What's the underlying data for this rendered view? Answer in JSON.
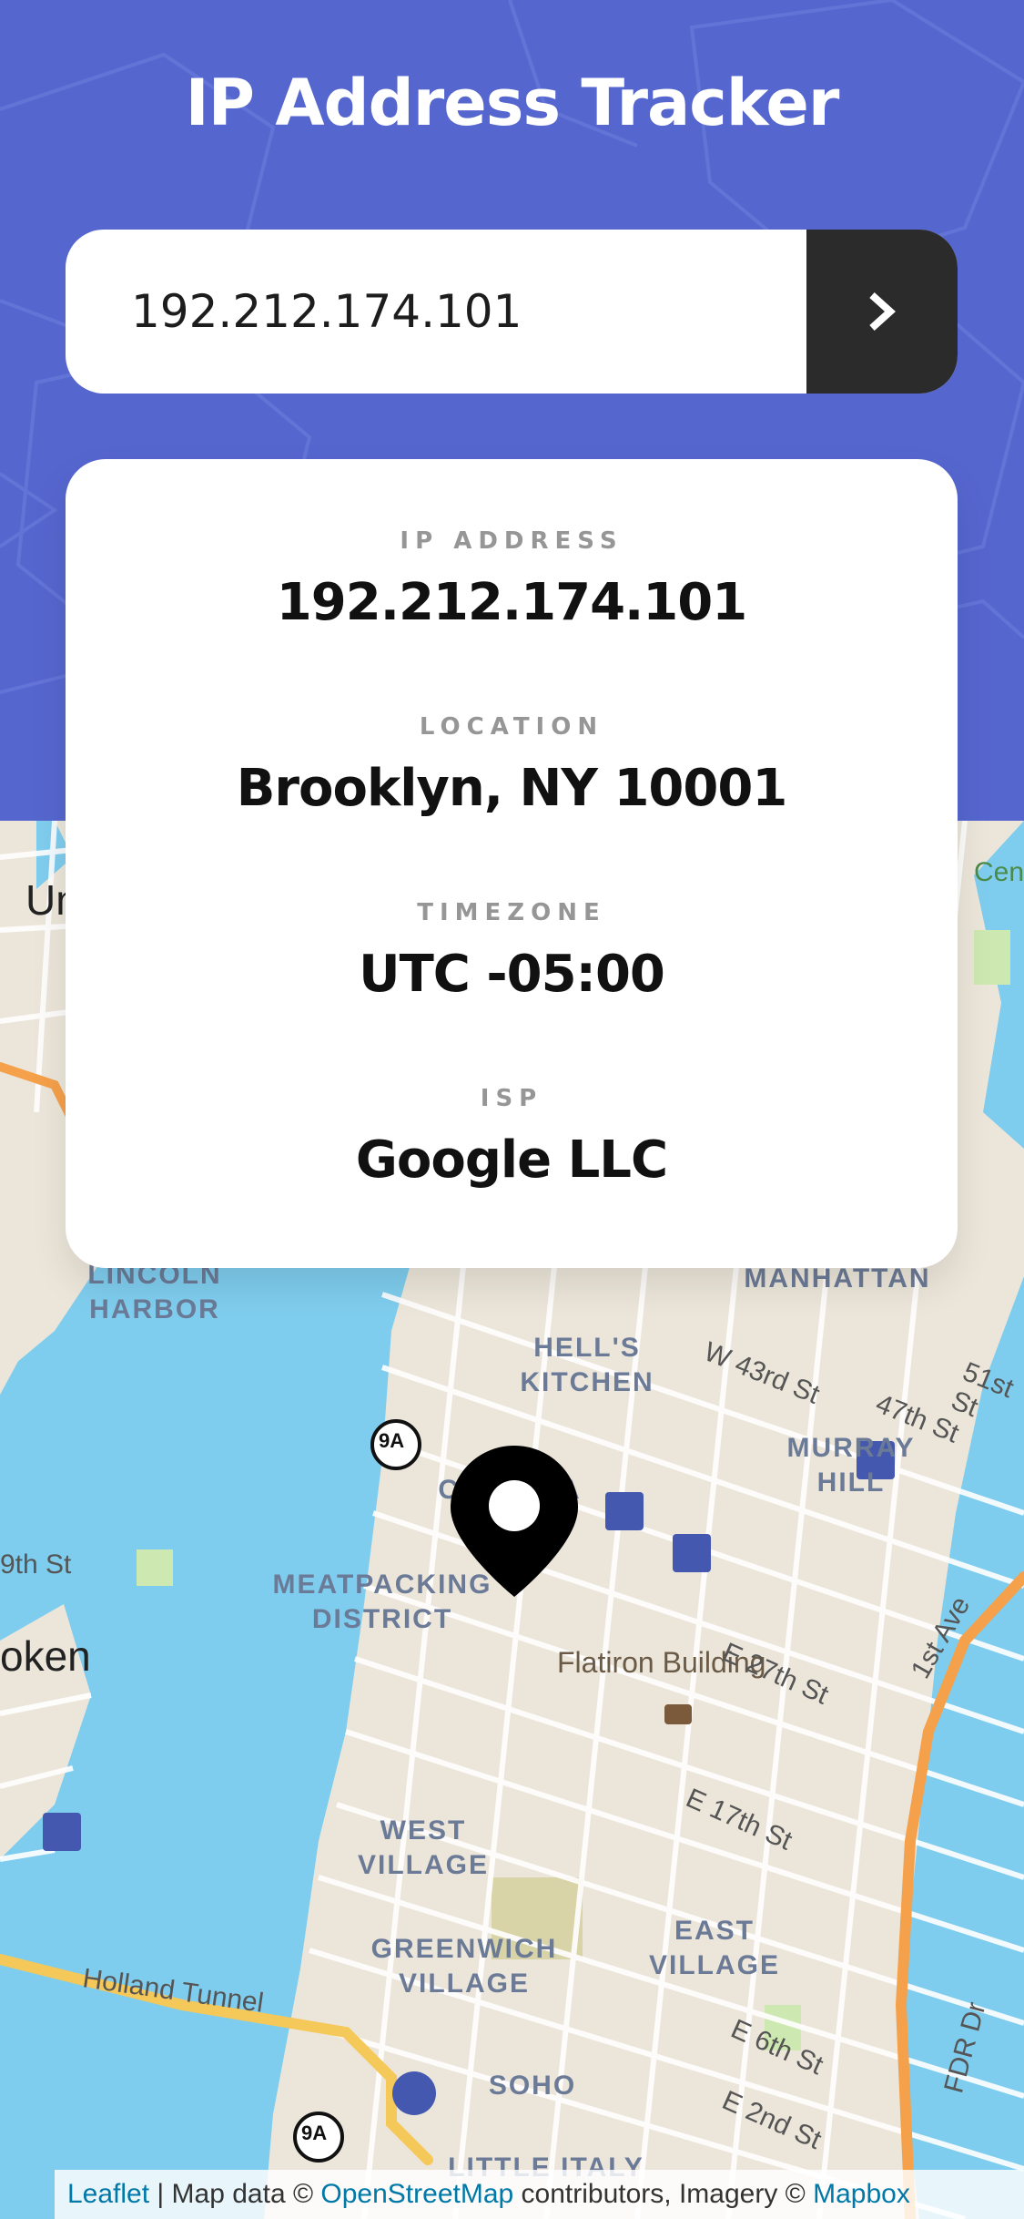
{
  "header": {
    "title": "IP Address Tracker"
  },
  "search": {
    "value": "192.212.174.101",
    "submit_icon": "chevron-right-icon"
  },
  "info": {
    "ip_label": "IP ADDRESS",
    "ip_value": "192.212.174.101",
    "location_label": "LOCATION",
    "location_value": "Brooklyn, NY 10001",
    "timezone_label": "TIMEZONE",
    "timezone_value": "UTC -05:00",
    "isp_label": "ISP",
    "isp_value": "Google LLC"
  },
  "map": {
    "marker_icon": "location-pin-icon",
    "labels": {
      "lincoln_harbor": "LINCOLN\nHARBOR",
      "manhattan": "MANHATTAN",
      "hells_kitchen": "HELL'S\nKITCHEN",
      "chelsea": "CHELSEA",
      "murray_hill": "MURRAY\nHILL",
      "meatpacking": "MEATPACKING\nDISTRICT",
      "flatiron": "Flatiron Building",
      "west_village": "WEST\nVILLAGE",
      "greenwich_village": "GREENWICH\nVILLAGE",
      "east_village": "EAST\nVILLAGE",
      "soho": "SOHO",
      "little_italy": "LITTLE ITALY",
      "oken": "oken",
      "un": "Un",
      "cen": "Cen",
      "holland_tunnel": "Holland Tunnel",
      "w43": "W 43rd St",
      "st51": "51st St",
      "st47": "47th St",
      "e27": "E 27th St",
      "e17": "E 17th St",
      "e6": "E 6th St",
      "e2": "E 2nd St",
      "first_ave": "1st Ave",
      "fdr": "FDR Dr",
      "ninth_st": "9th St",
      "route_9a": "9A"
    },
    "attribution": {
      "leaflet": "Leaflet",
      "sep": " | Map data © ",
      "osm": "OpenStreetMap",
      "mid": " contributors, Imagery © ",
      "mapbox": "Mapbox"
    }
  },
  "colors": {
    "header_bg": "#5566cf",
    "button_bg": "#2b2b2b",
    "water": "#7fcdee",
    "park": "#cde8b0",
    "highway": "#f5a04a"
  }
}
